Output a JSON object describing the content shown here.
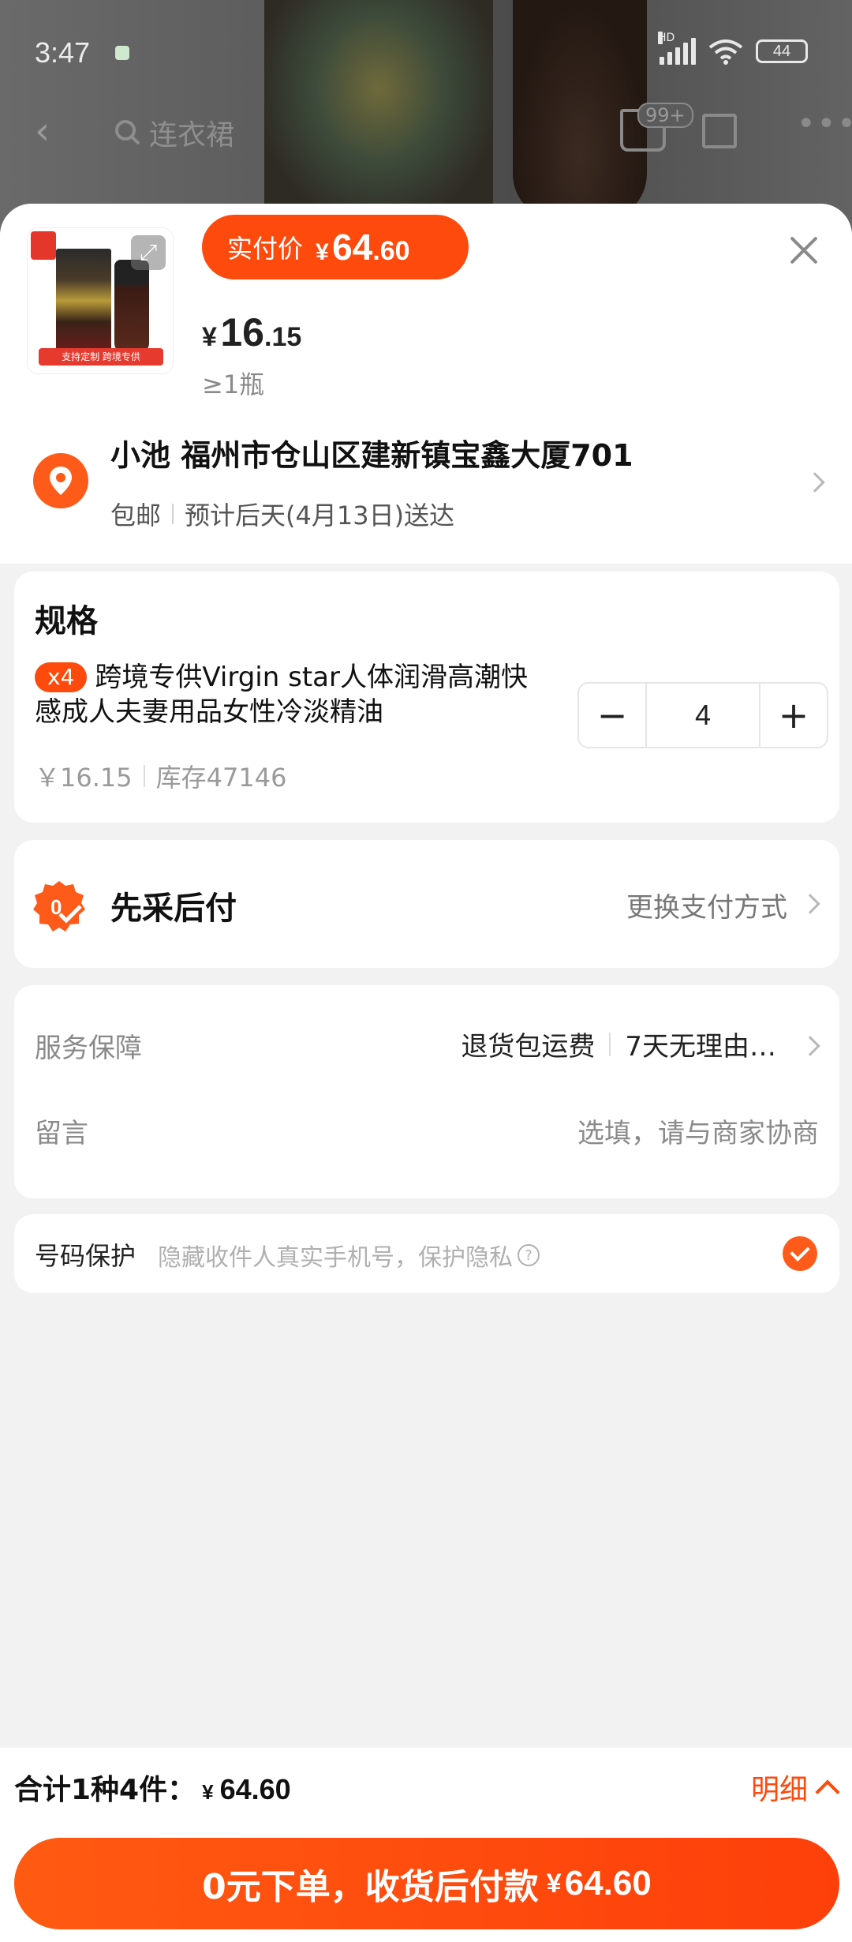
{
  "status_bar": {
    "time": "3:47",
    "network": "HD",
    "battery": "44"
  },
  "background_page": {
    "search_text": "连衣裙",
    "cart_badge": "99+"
  },
  "product": {
    "thumb_banner": "支持定制  跨境专供",
    "actual_pay_label": "实付价",
    "actual_pay_currency": "¥",
    "actual_pay_int": "64",
    "actual_pay_dec": ".60",
    "unit_currency": "¥",
    "unit_int": "16",
    "unit_dec": ".15",
    "min_order": "≥1瓶"
  },
  "address": {
    "line": "小池 福州市仓山区建新镇宝鑫大厦701",
    "shipping": "包邮",
    "eta": "预计后天(4月13日)送达"
  },
  "spec": {
    "title": "规格",
    "qty_badge": "x4",
    "name": "跨境专供Virgin star人体润滑高潮快感成人夫妻用品女性冷淡精油",
    "price": "￥16.15",
    "stock": "库存47146",
    "quantity": "4",
    "minus": "−",
    "plus": "+"
  },
  "payment": {
    "title": "先采后付",
    "change": "更换支付方式"
  },
  "service": {
    "label": "服务保障",
    "item1": "退货包运费",
    "item2": "7天无理由…",
    "message_label": "留言",
    "message_placeholder": "选填，请与商家协商"
  },
  "privacy": {
    "label": "号码保护",
    "desc": "隐藏收件人真实手机号，保护隐私",
    "checked": true
  },
  "footer": {
    "total_label": "合计1种4件：",
    "total_currency": "¥",
    "total_amount": "64.60",
    "detail": "明细",
    "submit_text": "0元下单，收货后付款",
    "submit_currency": "¥",
    "submit_amount": "64.60"
  },
  "colors": {
    "accent": "#fe4a0c",
    "pin": "#fe5a1a"
  }
}
